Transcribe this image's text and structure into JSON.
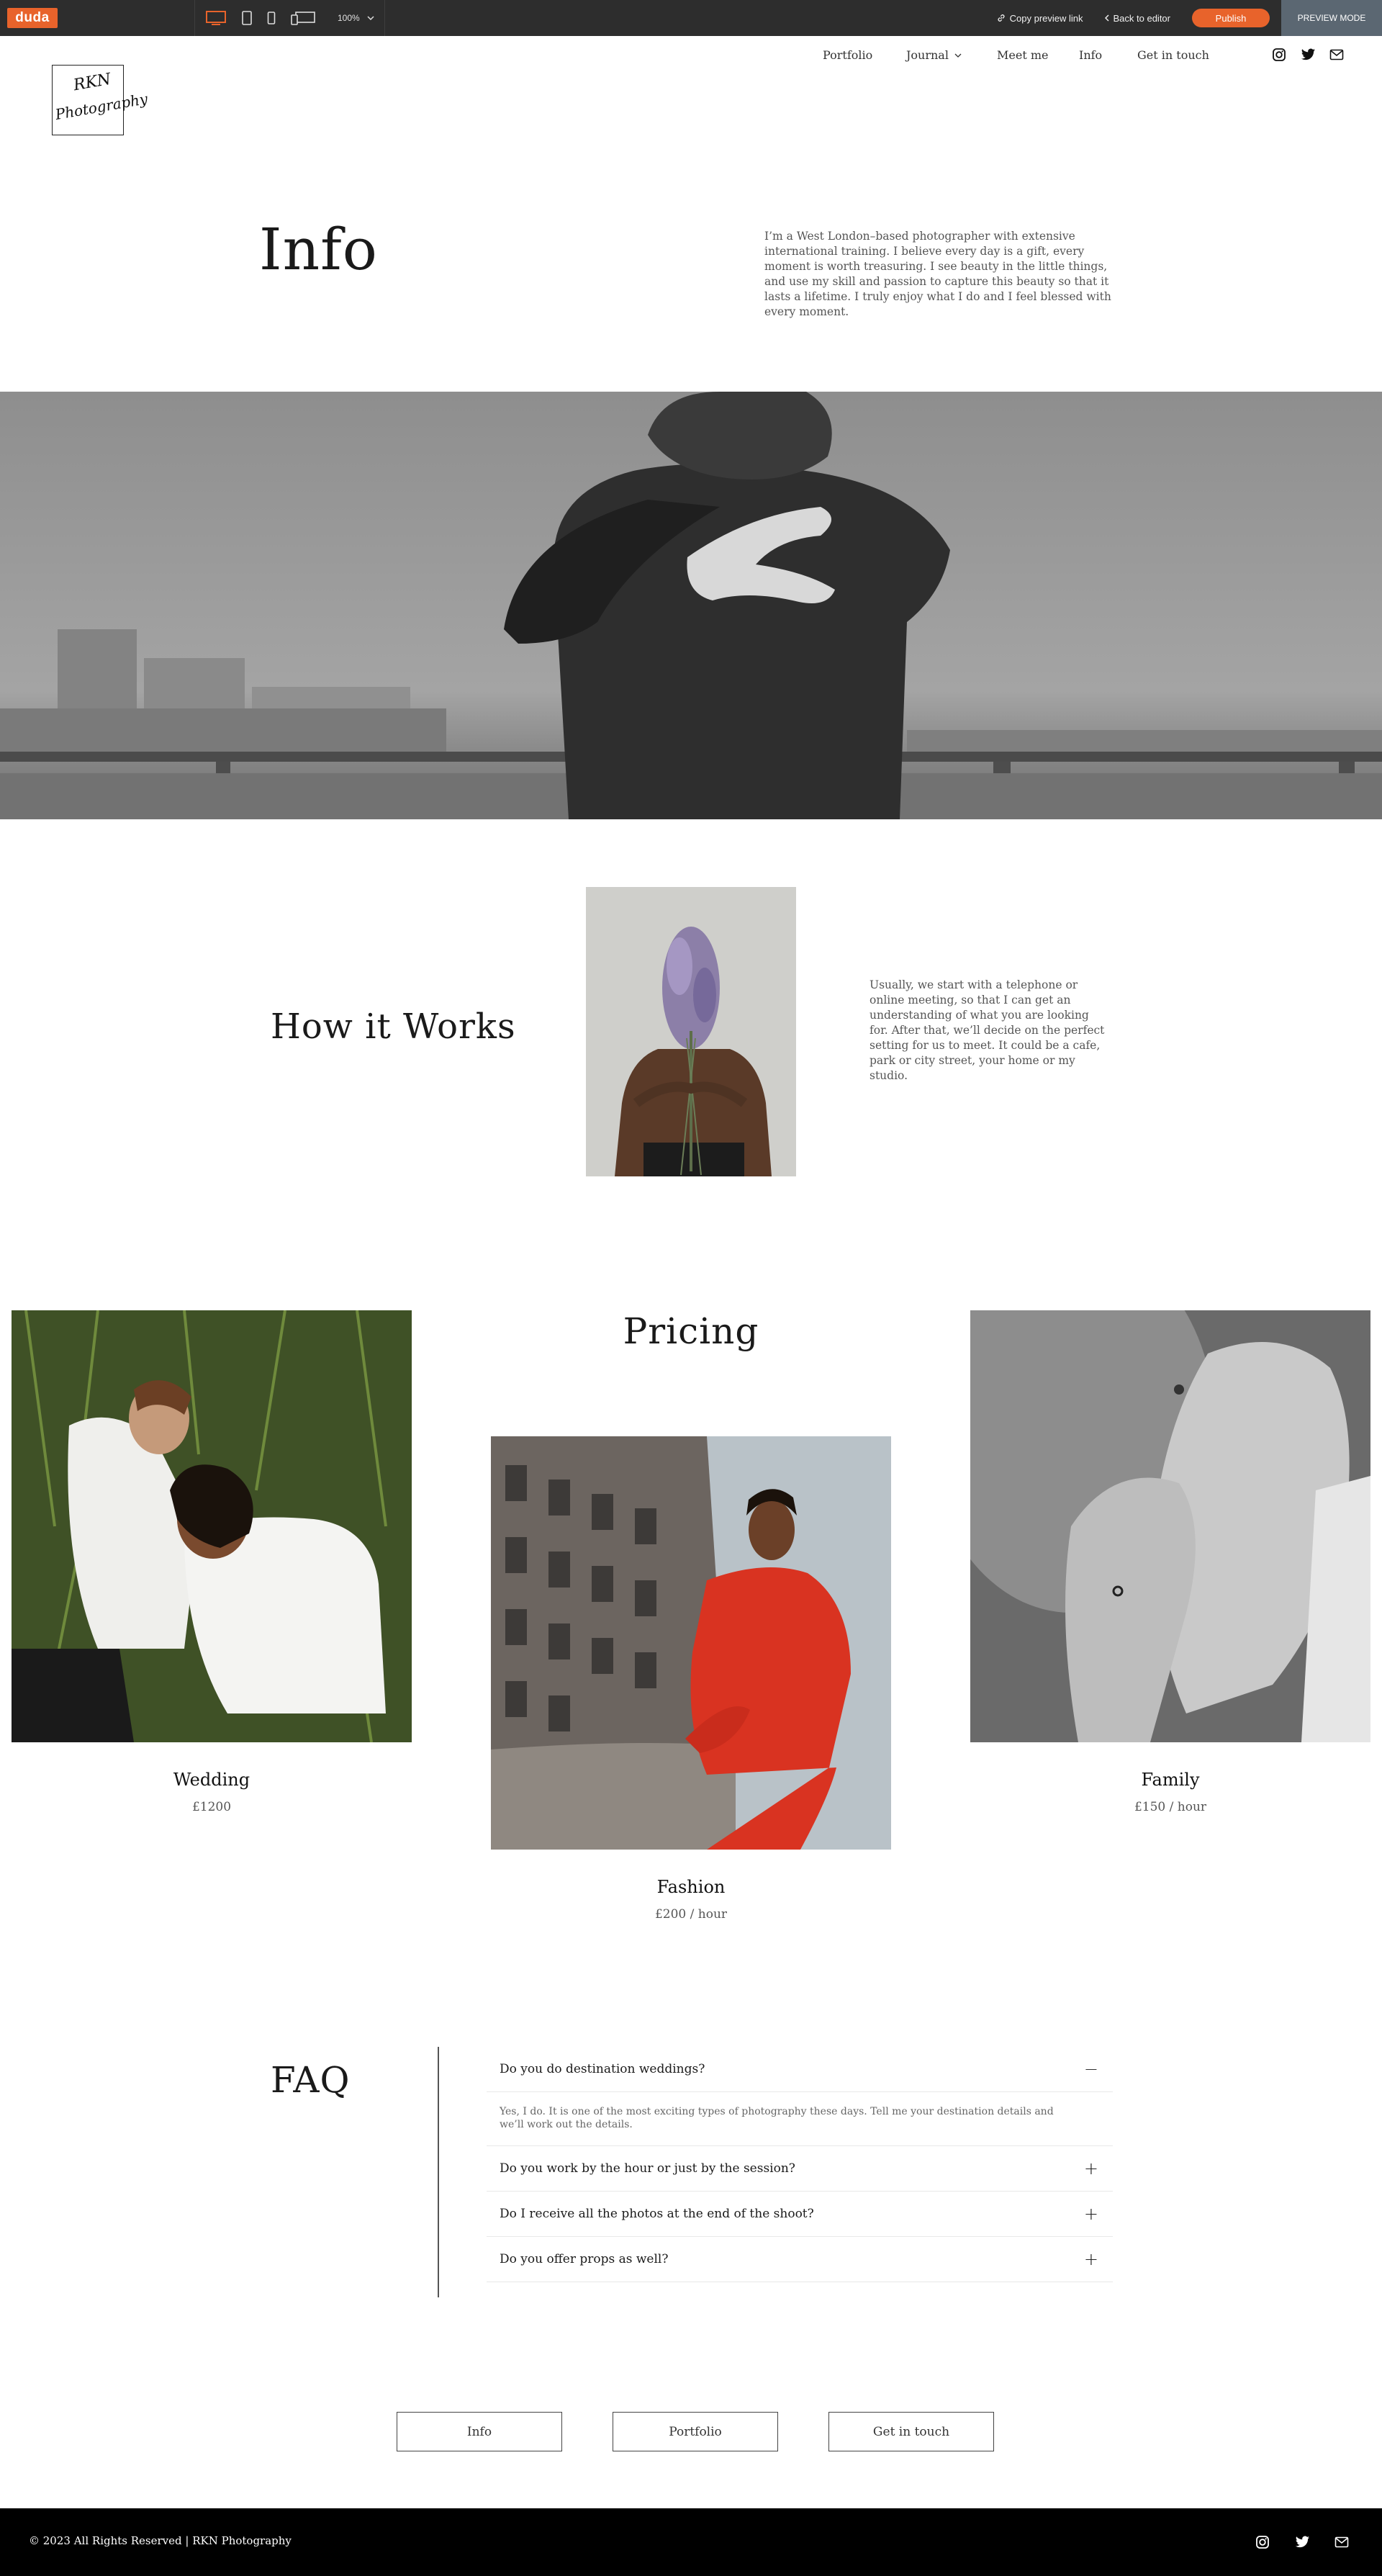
{
  "editor": {
    "brand": "duda",
    "zoom": "100%",
    "copy_preview_link": "Copy preview link",
    "back_to_editor": "Back to editor",
    "publish": "Publish",
    "preview_mode": "PREVIEW MODE",
    "accent_color": "#e8632b"
  },
  "site": {
    "logo_line1": "RKN",
    "logo_line2": "Photography",
    "nav": [
      "Portfolio",
      "Journal",
      "Meet me",
      "Info",
      "Get in touch"
    ],
    "social_icons": [
      "instagram-icon",
      "twitter-icon",
      "mail-icon"
    ]
  },
  "info": {
    "title": "Info",
    "text": "I’m a West London–based photographer with extensive international training. I believe every day is a gift, every moment is worth treasuring. I see beauty in the little things, and use my skill and passion to capture this beauty so that it lasts a lifetime. I truly enjoy what I do and I feel blessed with every moment."
  },
  "how": {
    "title": "How it Works",
    "text": "Usually, we start with a telephone or online meeting, so that I can get an understanding of what you are looking for. After that, we’ll decide on the perfect setting for us to meet. It could be a cafe, park or city street, your home or my studio."
  },
  "pricing": {
    "title": "Pricing",
    "items": [
      {
        "name": "Wedding",
        "price": "£1200"
      },
      {
        "name": "Fashion",
        "price": "£200 / hour"
      },
      {
        "name": "Family",
        "price": "£150 / hour"
      }
    ]
  },
  "faq": {
    "title": "FAQ",
    "items": [
      {
        "q": "Do you do destination weddings?",
        "a": "Yes, I do. It is one of the most exciting types of photography these days. Tell me your destination details and we’ll work out the details.",
        "open": true
      },
      {
        "q": "Do you work by the hour or just by the session?",
        "open": false
      },
      {
        "q": "Do I receive all the photos at the end of the shoot?",
        "open": false
      },
      {
        "q": "Do you offer props as well?",
        "open": false
      }
    ]
  },
  "footer_buttons": [
    "Info",
    "Portfolio",
    "Get in touch"
  ],
  "footer": {
    "copyright": "© 2023 All Rights Reserved | RKN Photography"
  }
}
